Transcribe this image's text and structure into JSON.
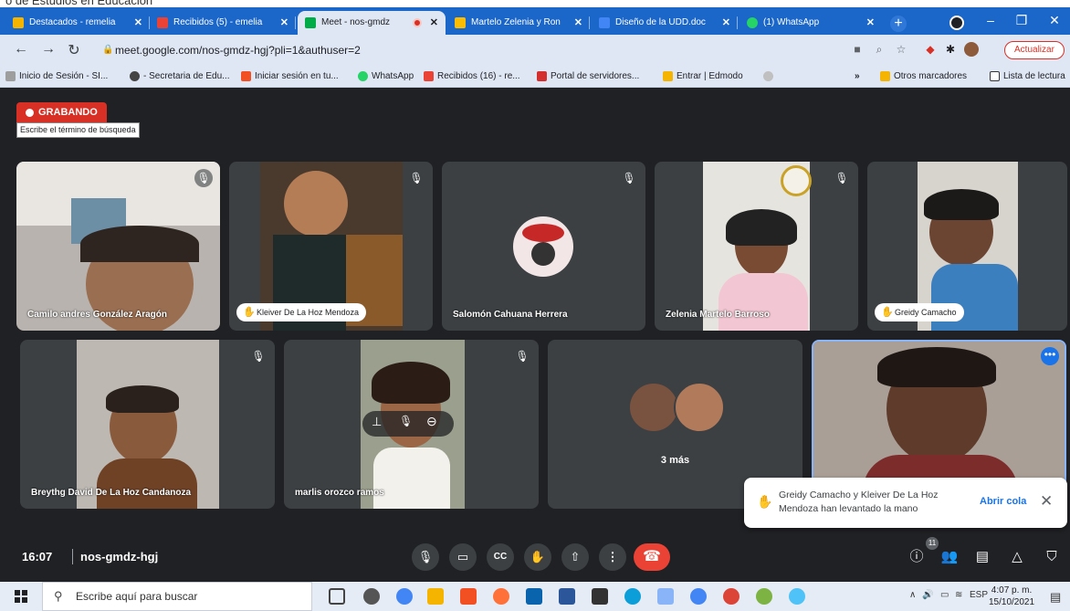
{
  "top_text": "o de Estudios en Educación",
  "tabs": [
    {
      "label": "Destacados - remelia",
      "color": "#f4b400"
    },
    {
      "label": "Recibidos (5) - emelia",
      "color": "#ea4335"
    },
    {
      "label": "Meet - nos-gmdz",
      "color": "#00ac47",
      "active": true
    },
    {
      "label": "Martelo Zelenia y Ron",
      "color": "#fbbc04"
    },
    {
      "label": "Diseño de la UDD.doc",
      "color": "#4285f4"
    },
    {
      "label": "(1) WhatsApp",
      "color": "#25d366"
    }
  ],
  "window": {
    "new_tab": "+",
    "minimize": "–",
    "restore": "❐",
    "close": "✕"
  },
  "address": {
    "url": "meet.google.com/nos-gmdz-hgj?pli=1&authuser=2",
    "update_label": "Actualizar"
  },
  "bookmarks": [
    {
      "label": "Inicio de Sesión - SI...",
      "color": "#9e9e9e"
    },
    {
      "label": "- Secretaria de Edu...",
      "color": "#444444"
    },
    {
      "label": "Iniciar sesión en tu...",
      "color": "#f25022"
    },
    {
      "label": "WhatsApp",
      "color": "#25d366"
    },
    {
      "label": "Recibidos (16) - re...",
      "color": "#ea4335"
    },
    {
      "label": "Portal de servidores...",
      "color": "#d32f2f"
    },
    {
      "label": "Entrar | Edmodo",
      "color": "#f4b400"
    }
  ],
  "bookmarks_more": "»",
  "bookmarks_other": "Otros marcadores",
  "bookmarks_reading": "Lista de lectura",
  "recording_label": "GRABANDO",
  "tooltip": "Escribe el término de búsqueda",
  "participants": [
    {
      "name": "Camilo andres González Aragón",
      "muted": true
    },
    {
      "name": "Kleiver De La Hoz Mendoza",
      "muted": true,
      "hand_raised": true
    },
    {
      "name": "Salomón Cahuana Herrera",
      "muted": true
    },
    {
      "name": "Zelenia Martelo Barroso",
      "muted": true
    },
    {
      "name": "Greidy Camacho",
      "muted": true,
      "hand_raised": true
    },
    {
      "name": "Breythg David De La Hoz Candanoza",
      "muted": true
    },
    {
      "name": "marlis orozco ramos",
      "muted": true
    },
    {
      "name": "3 más"
    },
    {
      "name": "",
      "self": true
    }
  ],
  "notification": {
    "text": "Greidy Camacho y Kleiver De La Hoz Mendoza han levantado la mano",
    "action": "Abrir cola"
  },
  "meeting": {
    "time": "16:07",
    "code": "nos-gmdz-hgj",
    "participant_count": "11"
  },
  "taskbar": {
    "search_placeholder": "Escribe aquí para buscar",
    "lang": "ESP",
    "time": "4:07 p. m.",
    "date": "15/10/2021"
  }
}
